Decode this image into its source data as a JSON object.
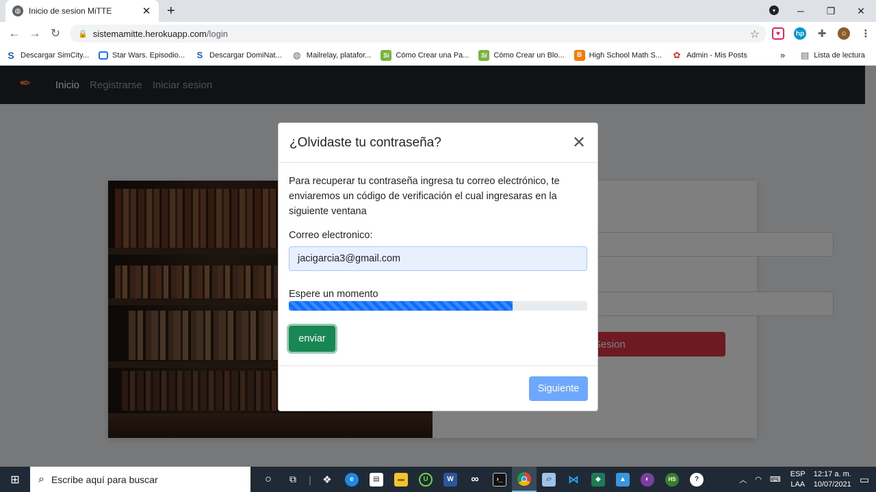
{
  "browser": {
    "tab_title": "Inicio de sesion MiTTE",
    "tab_close": "✕",
    "new_tab": "+",
    "url_host": "sistemamitte.herokuapp.com",
    "url_path": "/login",
    "bookmarks": [
      {
        "label": "Descargar SimCity...",
        "icon": "S",
        "color": "#1a5fb4",
        "bg": "#fff"
      },
      {
        "label": "Star Wars. Episodio...",
        "icon": "▭",
        "color": "#1a73e8",
        "bg": "#fff"
      },
      {
        "label": "Descargar DomiNat...",
        "icon": "S",
        "color": "#1a5fb4",
        "bg": "#fff"
      },
      {
        "label": "Mailrelay, platafor...",
        "icon": "◉",
        "color": "#5f6368",
        "bg": "#fff"
      },
      {
        "label": "Cómo Crear una Pa...",
        "icon": "Sí",
        "color": "#fff",
        "bg": "#7cb342"
      },
      {
        "label": "Cómo Crear un Blo...",
        "icon": "Sí",
        "color": "#fff",
        "bg": "#7cb342"
      },
      {
        "label": "High School Math S...",
        "icon": "B",
        "color": "#fff",
        "bg": "#f57c00"
      },
      {
        "label": "Admin - Mis Posts",
        "icon": "✿",
        "color": "#d93025",
        "bg": "#fff"
      }
    ],
    "bookmarks_more": "»",
    "reading_list": "Lista de lectura"
  },
  "site_nav": {
    "links": [
      "Inicio",
      "Registrarse",
      "Iniciar sesion"
    ]
  },
  "login": {
    "button_label": "Sesion"
  },
  "modal": {
    "title": "¿Olvidaste tu contraseña?",
    "close": "✕",
    "description": "Para recuperar tu contraseña ingresa tu correo electrónico, te enviaremos un código de verificación el cual ingresaras en la siguiente ventana",
    "email_label": "Correo electronico:",
    "email_value": "jacigarcia3@gmail.com",
    "wait_label": "Espere un momento",
    "progress_fraction": 0.75,
    "send_button": "enviar",
    "next_button": "Siguiente"
  },
  "taskbar": {
    "search_placeholder": "Escribe aquí para buscar",
    "lang_top": "ESP",
    "lang_bottom": "LAA",
    "time": "12:17 a. m.",
    "date": "10/07/2021"
  }
}
